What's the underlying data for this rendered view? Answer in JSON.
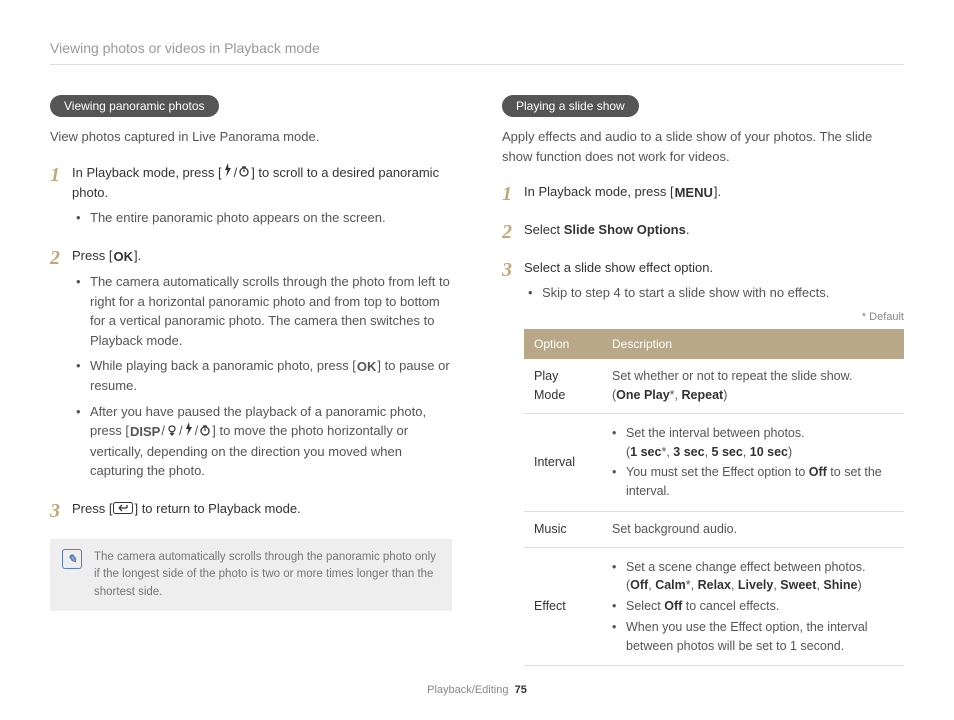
{
  "breadcrumb": "Viewing photos or videos in Playback mode",
  "left": {
    "heading": "Viewing panoramic photos",
    "intro": "View photos captured in Live Panorama mode.",
    "step1_pre": "In Playback mode, press [",
    "step1_post": "] to scroll to a desired panoramic photo.",
    "step1_bullet1": "The entire panoramic photo appears on the screen.",
    "step2_pre": "Press [",
    "step2_post": "].",
    "step2_bullet1": "The camera automatically scrolls through the photo from left to right for a horizontal panoramic photo and from top to bottom for a vertical panoramic photo. The camera then switches to Playback mode.",
    "step2_bullet2_pre": "While playing back a panoramic photo, press [",
    "step2_bullet2_post": "] to pause or resume.",
    "step2_bullet3_pre": "After you have paused the playback of a panoramic photo, press [",
    "step2_bullet3_post": "] to move the photo horizontally or vertically, depending on the direction you moved when capturing the photo.",
    "step3_pre": "Press [",
    "step3_post": "] to return to Playback mode.",
    "note": "The camera automatically scrolls through the panoramic photo only if the longest side of the photo is two or more times longer than the shortest side."
  },
  "right": {
    "heading": "Playing a slide show",
    "intro": "Apply effects and audio to a slide show of your photos. The slide show function does not work for videos.",
    "step1_pre": "In Playback mode, press [",
    "step1_post": "].",
    "step2_pre": "Select ",
    "step2_bold": "Slide Show Options",
    "step2_post": ".",
    "step3_text": "Select a slide show effect option.",
    "step3_bullet1": "Skip to step 4 to start a slide show with no effects.",
    "default_label": "* Default",
    "table": {
      "header_option": "Option",
      "header_description": "Description",
      "rows": {
        "playmode_label": "Play Mode",
        "playmode_desc_a": "Set whether or not to repeat the slide show.",
        "playmode_desc_b_pre": "(",
        "playmode_desc_b1": "One Play",
        "playmode_desc_star": "*",
        "playmode_desc_sep": ", ",
        "playmode_desc_b2": "Repeat",
        "playmode_desc_b_post": ")",
        "interval_label": "Interval",
        "interval_b1_pre": "Set the interval between photos.",
        "interval_b1_line2_pre": "(",
        "interval_b1_v1": "1 sec",
        "interval_b1_v2": "3 sec",
        "interval_b1_v3": "5 sec",
        "interval_b1_v4": "10 sec",
        "interval_b1_line2_post": ")",
        "interval_b2_pre": "You must set the Effect option to ",
        "interval_b2_bold": "Off",
        "interval_b2_post": " to set the interval.",
        "music_label": "Music",
        "music_desc": "Set background audio.",
        "effect_label": "Effect",
        "effect_b1_pre": "Set a scene change effect between photos.",
        "effect_b1_line2_pre": "(",
        "effect_b1_v1": "Off",
        "effect_b1_v2": "Calm",
        "effect_b1_v3": "Relax",
        "effect_b1_v4": "Lively",
        "effect_b1_v5": "Sweet",
        "effect_b1_v6": "Shine",
        "effect_b1_line2_post": ")",
        "effect_b2_pre": "Select ",
        "effect_b2_bold": "Off",
        "effect_b2_post": " to cancel effects.",
        "effect_b3": "When you use the Effect option, the interval between photos will be set to 1 second."
      }
    }
  },
  "icons": {
    "ok": "OK",
    "menu": "MENU",
    "disp": "DISP"
  },
  "footer": {
    "section": "Playback/Editing",
    "page": "75"
  }
}
